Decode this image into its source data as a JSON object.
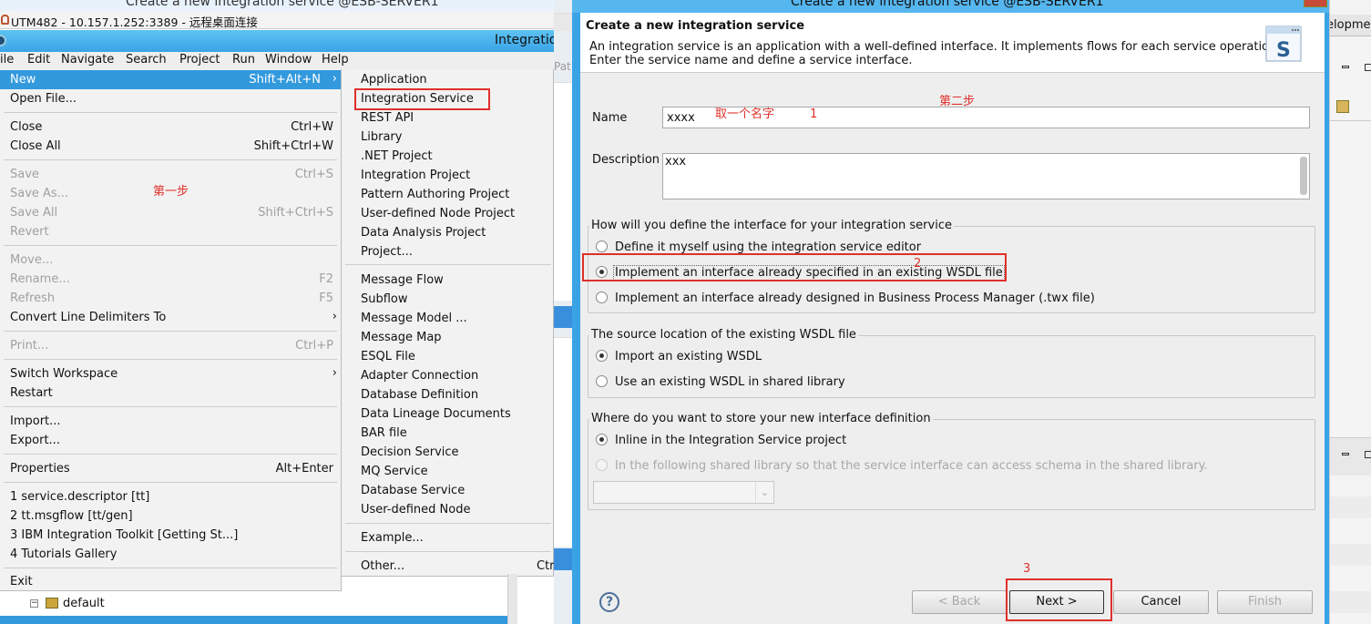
{
  "rdp": {
    "window_title": "Create a new integration service @ESB-SERVER1",
    "connection_title": "UTM482 - 10.157.1.252:3389 - 远程桌面连接"
  },
  "app": {
    "title": "Integratio",
    "menubar": [
      "ile",
      "Edit",
      "Navigate",
      "Search",
      "Project",
      "Run",
      "Window",
      "Help"
    ]
  },
  "file_menu": {
    "new": {
      "label": "New",
      "shortcut": "Shift+Alt+N"
    },
    "open_file": "Open File...",
    "close": {
      "label": "Close",
      "shortcut": "Ctrl+W"
    },
    "close_all": {
      "label": "Close All",
      "shortcut": "Shift+Ctrl+W"
    },
    "save": {
      "label": "Save",
      "shortcut": "Ctrl+S"
    },
    "save_as": "Save As...",
    "save_all": {
      "label": "Save All",
      "shortcut": "Shift+Ctrl+S"
    },
    "revert": "Revert",
    "move": "Move...",
    "rename": {
      "label": "Rename...",
      "shortcut": "F2"
    },
    "refresh": {
      "label": "Refresh",
      "shortcut": "F5"
    },
    "convert": "Convert Line Delimiters To",
    "print": {
      "label": "Print...",
      "shortcut": "Ctrl+P"
    },
    "switch_workspace": "Switch Workspace",
    "restart": "Restart",
    "import": "Import...",
    "export": "Export...",
    "properties": {
      "label": "Properties",
      "shortcut": "Alt+Enter"
    },
    "recent": [
      "1 service.descriptor  [tt]",
      "2 tt.msgflow  [tt/gen]",
      "3 IBM Integration Toolkit  [Getting St...]",
      "4 Tutorials Gallery"
    ],
    "exit": "Exit"
  },
  "new_menu": {
    "group1": [
      "Application",
      "Integration Service",
      "REST API",
      "Library",
      ".NET Project",
      "Integration Project",
      "Pattern Authoring Project",
      "User-defined Node Project",
      "Data Analysis Project",
      "Project..."
    ],
    "group2": [
      "Message Flow",
      "Subflow",
      "Message Model ...",
      "Message Map",
      "ESQL File",
      "Adapter Connection",
      "Database Definition",
      "Data Lineage Documents",
      "BAR file",
      "Decision Service",
      "MQ Service",
      "Database Service",
      "User-defined Node"
    ],
    "example": "Example...",
    "other": "Other...",
    "other_shortcut_fragment": "Ctr"
  },
  "tree": {
    "default_label": "default"
  },
  "side_fragment": "Pat",
  "dialog": {
    "title": "Create a new integration service @ESB-SERVER1",
    "heading": "Create a new integration service",
    "description_line1": "An integration service is an application with a well-defined interface. It implements flows for each service operation.",
    "description_line2": "Enter the service name and define a service interface.",
    "name_label": "Name",
    "name_value": "xxxx",
    "desc_label": "Description",
    "desc_value": "xxx",
    "interface_group": {
      "title": "How will you define the interface for your integration service",
      "options": [
        {
          "label": "Define it myself using the integration service editor",
          "selected": false
        },
        {
          "label": "Implement an interface already specified in an existing WSDL file",
          "selected": true
        },
        {
          "label": "Implement an interface already designed in Business Process Manager (.twx file)",
          "selected": false
        }
      ]
    },
    "source_group": {
      "title": "The source location of the existing WSDL file",
      "options": [
        {
          "label": "Import an existing WSDL",
          "selected": true
        },
        {
          "label": "Use an existing WSDL in shared library",
          "selected": false
        }
      ]
    },
    "store_group": {
      "title": "Where do you want to store your new interface definition",
      "options": [
        {
          "label": "Inline in the Integration Service project",
          "selected": true
        },
        {
          "label": "In the following shared library so that the service interface can access schema in the shared library.",
          "selected": false
        }
      ]
    },
    "buttons": {
      "back": "< Back",
      "next": "Next >",
      "cancel": "Cancel",
      "finish": "Finish"
    }
  },
  "annotations": {
    "step1": "第一步",
    "step2": "第二步",
    "give_name": "取一个名字",
    "n1": "1",
    "n2": "2",
    "n3": "3"
  },
  "right_ide": {
    "tab_fragment": "elopme"
  },
  "colors": {
    "accent": "#3399dd",
    "annotation_red": "#e0302a",
    "title_blue": "#3aa3e6"
  }
}
